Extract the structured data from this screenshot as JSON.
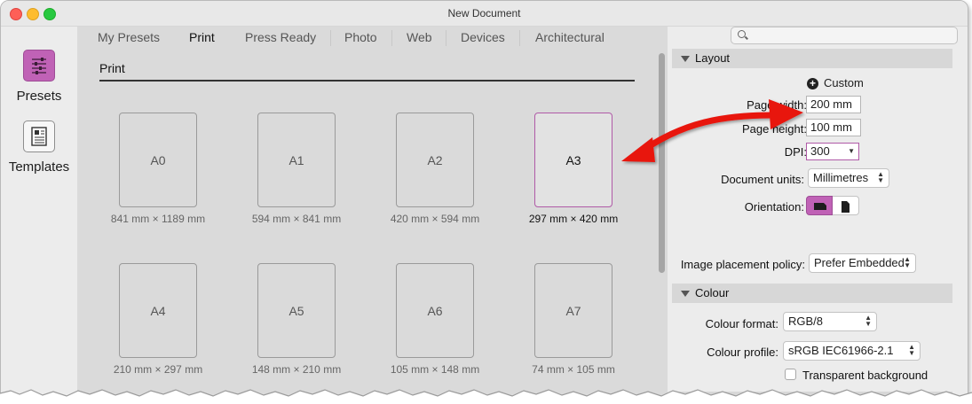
{
  "window": {
    "title": "New Document"
  },
  "sidebar": {
    "items": [
      {
        "label": "Presets",
        "icon": "sliders-icon"
      },
      {
        "label": "Templates",
        "icon": "document-icon"
      }
    ]
  },
  "tabs": [
    "My Presets",
    "Print",
    "Press Ready",
    "Photo",
    "Web",
    "Devices",
    "Architectural"
  ],
  "active_tab": "Print",
  "section_title": "Print",
  "presets": [
    {
      "name": "A0",
      "dims": "841 mm × 1189 mm"
    },
    {
      "name": "A1",
      "dims": "594 mm × 841 mm"
    },
    {
      "name": "A2",
      "dims": "420 mm × 594 mm"
    },
    {
      "name": "A3",
      "dims": "297 mm × 420 mm",
      "selected": true
    },
    {
      "name": "A4",
      "dims": "210 mm × 297 mm"
    },
    {
      "name": "A5",
      "dims": "148 mm × 210 mm"
    },
    {
      "name": "A6",
      "dims": "105 mm × 148 mm"
    },
    {
      "name": "A7",
      "dims": "74 mm × 105 mm"
    }
  ],
  "layout": {
    "header": "Layout",
    "custom_label": "Custom",
    "page_width_label": "Page width:",
    "page_width_value": "200 mm",
    "page_height_label": "Page height:",
    "page_height_value": "100 mm",
    "dpi_label": "DPI:",
    "dpi_value": "300",
    "units_label": "Document units:",
    "units_value": "Millimetres",
    "orientation_label": "Orientation:",
    "orientation_selected": "landscape",
    "image_policy_label": "Image placement policy:",
    "image_policy_value": "Prefer Embedded"
  },
  "colour": {
    "header": "Colour",
    "format_label": "Colour format:",
    "format_value": "RGB/8",
    "profile_label": "Colour profile:",
    "profile_value": "sRGB IEC61966-2.1",
    "transparent_label": "Transparent background",
    "transparent_checked": false
  },
  "colors": {
    "accent": "#c062b6",
    "annotation_arrow": "#e8140f",
    "close": "#fe5f57",
    "minimize": "#febc2e",
    "zoom": "#28c840"
  }
}
